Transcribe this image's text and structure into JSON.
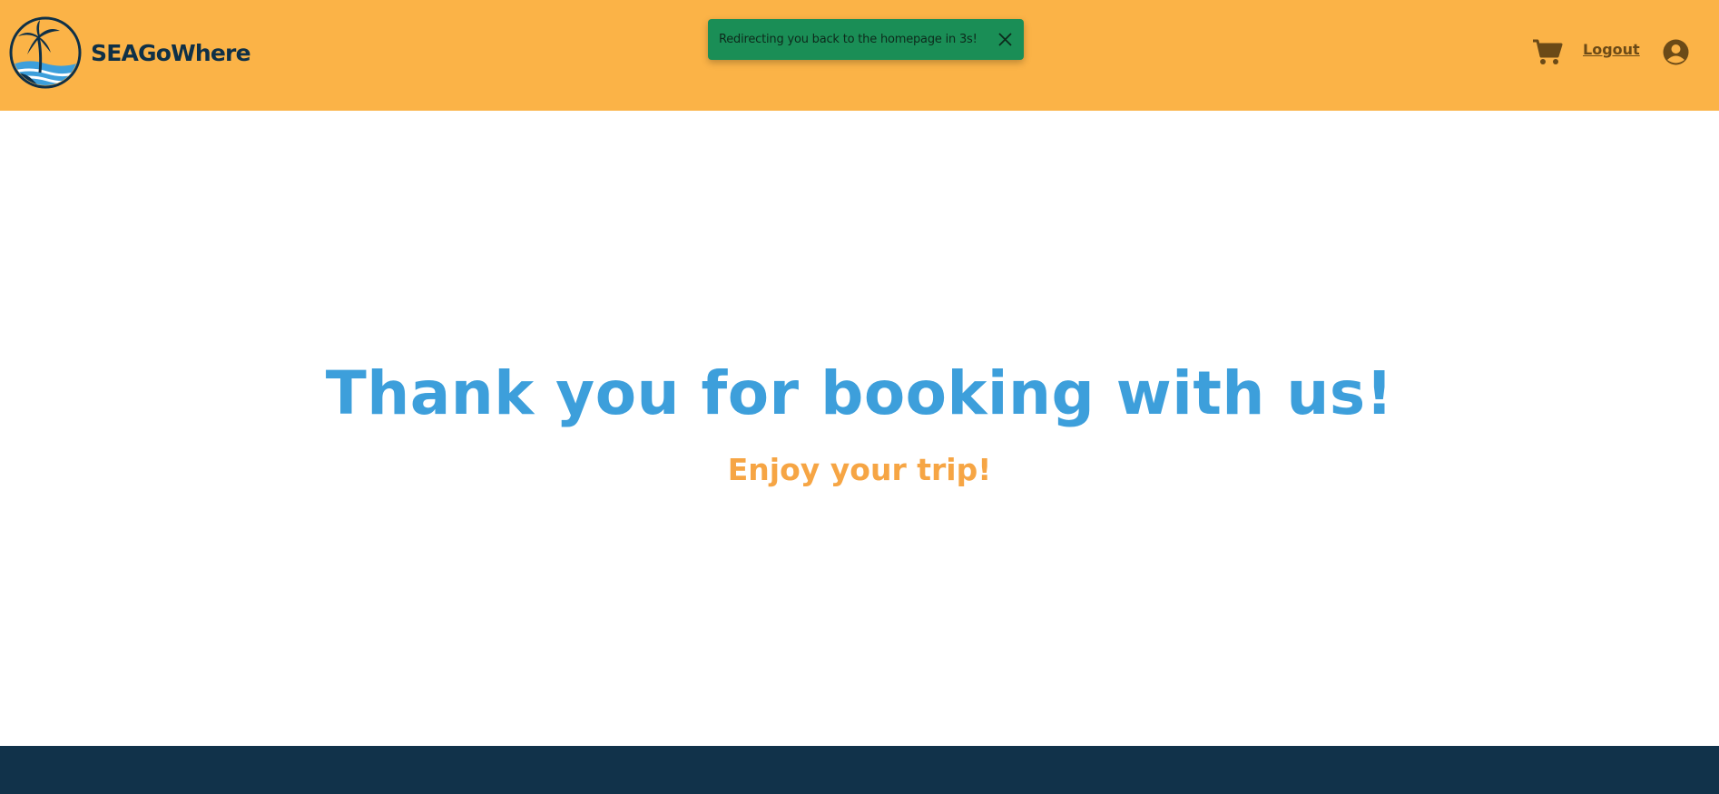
{
  "header": {
    "brand": "SEAGoWhere",
    "logout_label": "Logout",
    "cart_icon": "shopping-cart-icon",
    "user_icon": "user-circle-icon",
    "background": "#fbb347"
  },
  "toast": {
    "message": "Redirecting you back to the homepage in 3s!",
    "close_icon": "close-icon",
    "background": "#1a8e56"
  },
  "main": {
    "headline": "Thank you for booking with us!",
    "subheadline": "Enjoy your trip!",
    "headline_color": "#3d9fdb",
    "subheadline_color": "#f6a544"
  },
  "footer": {
    "background": "#11324a"
  }
}
